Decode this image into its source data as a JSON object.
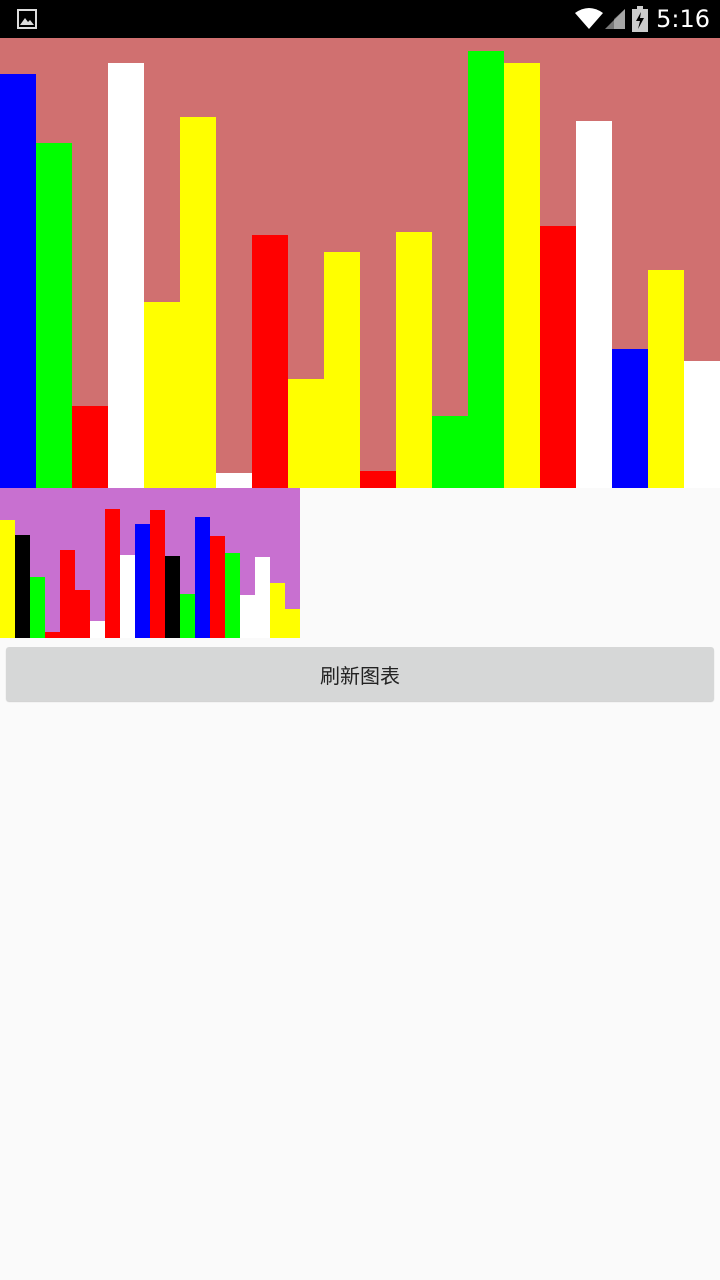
{
  "status_bar": {
    "time": "5:16",
    "icons": [
      "image-notification-icon",
      "wifi-icon",
      "cell-signal-icon",
      "battery-charging-icon"
    ]
  },
  "colors": {
    "large_chart_background": "#d07070",
    "small_chart_background": "#c870d0",
    "page_background": "#fafafa",
    "button_background": "#d6d7d7"
  },
  "chart_data": [
    {
      "type": "bar",
      "ylim": [
        0,
        450
      ],
      "grid": false,
      "values": [
        414,
        345,
        82,
        425,
        186,
        371,
        15,
        253,
        109,
        236,
        17,
        256,
        72,
        437,
        425,
        262,
        367,
        139,
        218,
        127
      ],
      "colors": [
        "#0000ff",
        "#00ff00",
        "#ff0000",
        "#ffffff",
        "#ffff00",
        "#ffff00",
        "#ffffff",
        "#ff0000",
        "#ffff00",
        "#ffff00",
        "#ff0000",
        "#ffff00",
        "#00ff00",
        "#00ff00",
        "#ffff00",
        "#ff0000",
        "#ffffff",
        "#0000ff",
        "#ffff00",
        "#ffffff"
      ]
    },
    {
      "type": "bar",
      "ylim": [
        0,
        150
      ],
      "grid": false,
      "values": [
        118,
        103,
        61,
        6,
        88,
        48,
        17,
        129,
        83,
        114,
        128,
        82,
        44,
        121,
        102,
        85,
        43,
        81,
        55,
        29
      ],
      "colors": [
        "#ffff00",
        "#000000",
        "#00ff00",
        "#ff0000",
        "#ff0000",
        "#ff0000",
        "#ffffff",
        "#ff0000",
        "#ffffff",
        "#0000ff",
        "#ff0000",
        "#000000",
        "#00ff00",
        "#0000ff",
        "#ff0000",
        "#00ff00",
        "#ffffff",
        "#ffffff",
        "#ffff00",
        "#ffff00"
      ]
    }
  ],
  "button": {
    "refresh_label": "刷新图表"
  }
}
